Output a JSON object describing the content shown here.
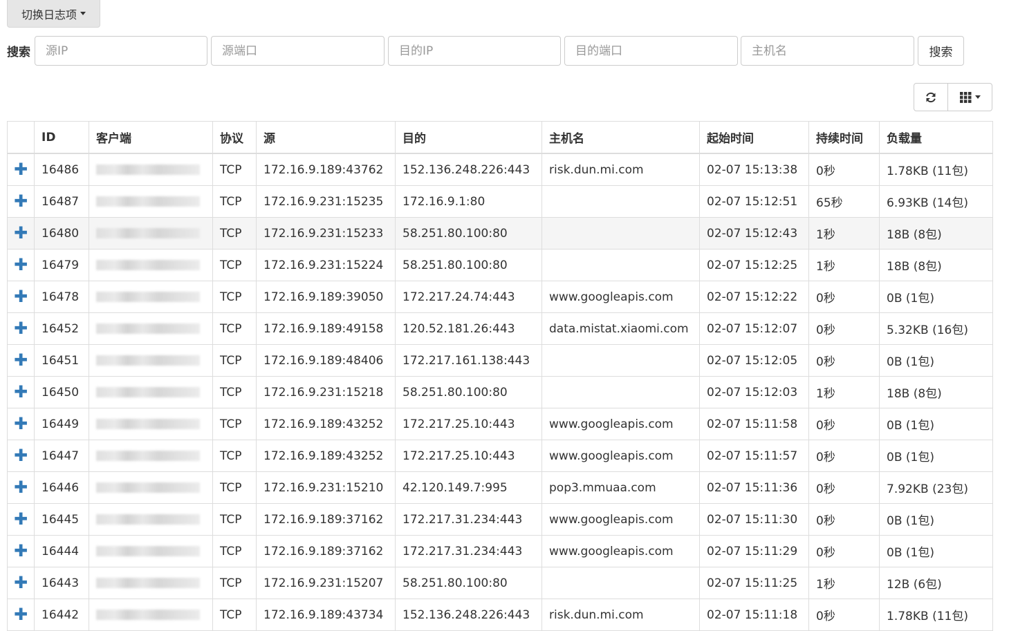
{
  "toolbar": {
    "switch_label": "切换日志项"
  },
  "search": {
    "label": "搜索",
    "src_ip_placeholder": "源IP",
    "src_port_placeholder": "源端口",
    "dst_ip_placeholder": "目的IP",
    "dst_port_placeholder": "目的端口",
    "hostname_placeholder": "主机名",
    "button_label": "搜索"
  },
  "tools": {
    "refresh_icon": "refresh-icon",
    "columns_icon": "grid-icon"
  },
  "table": {
    "headers": [
      "",
      "ID",
      "客户端",
      "协议",
      "源",
      "目的",
      "主机名",
      "起始时间",
      "持续时间",
      "负载量"
    ],
    "expand_symbol": "✚",
    "rows": [
      {
        "id": "16486",
        "protocol": "TCP",
        "source": "172.16.9.189:43762",
        "dest": "152.136.248.226:443",
        "hostname": "risk.dun.mi.com",
        "start": "02-07 15:13:38",
        "duration": "0秒",
        "payload": "1.78KB (11包)"
      },
      {
        "id": "16487",
        "protocol": "TCP",
        "source": "172.16.9.231:15235",
        "dest": "172.16.9.1:80",
        "hostname": "",
        "start": "02-07 15:12:51",
        "duration": "65秒",
        "payload": "6.93KB (14包)"
      },
      {
        "id": "16480",
        "protocol": "TCP",
        "source": "172.16.9.231:15233",
        "dest": "58.251.80.100:80",
        "hostname": "",
        "start": "02-07 15:12:43",
        "duration": "1秒",
        "payload": "18B (8包)"
      },
      {
        "id": "16479",
        "protocol": "TCP",
        "source": "172.16.9.231:15224",
        "dest": "58.251.80.100:80",
        "hostname": "",
        "start": "02-07 15:12:25",
        "duration": "1秒",
        "payload": "18B (8包)"
      },
      {
        "id": "16478",
        "protocol": "TCP",
        "source": "172.16.9.189:39050",
        "dest": "172.217.24.74:443",
        "hostname": "www.googleapis.com",
        "start": "02-07 15:12:22",
        "duration": "0秒",
        "payload": "0B (1包)"
      },
      {
        "id": "16452",
        "protocol": "TCP",
        "source": "172.16.9.189:49158",
        "dest": "120.52.181.26:443",
        "hostname": "data.mistat.xiaomi.com",
        "start": "02-07 15:12:07",
        "duration": "0秒",
        "payload": "5.32KB (16包)"
      },
      {
        "id": "16451",
        "protocol": "TCP",
        "source": "172.16.9.189:48406",
        "dest": "172.217.161.138:443",
        "hostname": "",
        "start": "02-07 15:12:05",
        "duration": "0秒",
        "payload": "0B (1包)"
      },
      {
        "id": "16450",
        "protocol": "TCP",
        "source": "172.16.9.231:15218",
        "dest": "58.251.80.100:80",
        "hostname": "",
        "start": "02-07 15:12:03",
        "duration": "1秒",
        "payload": "18B (8包)"
      },
      {
        "id": "16449",
        "protocol": "TCP",
        "source": "172.16.9.189:43252",
        "dest": "172.217.25.10:443",
        "hostname": "www.googleapis.com",
        "start": "02-07 15:11:58",
        "duration": "0秒",
        "payload": "0B (1包)"
      },
      {
        "id": "16447",
        "protocol": "TCP",
        "source": "172.16.9.189:43252",
        "dest": "172.217.25.10:443",
        "hostname": "www.googleapis.com",
        "start": "02-07 15:11:57",
        "duration": "0秒",
        "payload": "0B (1包)"
      },
      {
        "id": "16446",
        "protocol": "TCP",
        "source": "172.16.9.231:15210",
        "dest": "42.120.149.7:995",
        "hostname": "pop3.mmuaa.com",
        "start": "02-07 15:11:36",
        "duration": "0秒",
        "payload": "7.92KB (23包)"
      },
      {
        "id": "16445",
        "protocol": "TCP",
        "source": "172.16.9.189:37162",
        "dest": "172.217.31.234:443",
        "hostname": "www.googleapis.com",
        "start": "02-07 15:11:30",
        "duration": "0秒",
        "payload": "0B (1包)"
      },
      {
        "id": "16444",
        "protocol": "TCP",
        "source": "172.16.9.189:37162",
        "dest": "172.217.31.234:443",
        "hostname": "www.googleapis.com",
        "start": "02-07 15:11:29",
        "duration": "0秒",
        "payload": "0B (1包)"
      },
      {
        "id": "16443",
        "protocol": "TCP",
        "source": "172.16.9.231:15207",
        "dest": "58.251.80.100:80",
        "hostname": "",
        "start": "02-07 15:11:25",
        "duration": "1秒",
        "payload": "12B (6包)"
      },
      {
        "id": "16442",
        "protocol": "TCP",
        "source": "172.16.9.189:43734",
        "dest": "152.136.248.226:443",
        "hostname": "risk.dun.mi.com",
        "start": "02-07 15:11:18",
        "duration": "0秒",
        "payload": "1.78KB (11包)"
      }
    ]
  }
}
